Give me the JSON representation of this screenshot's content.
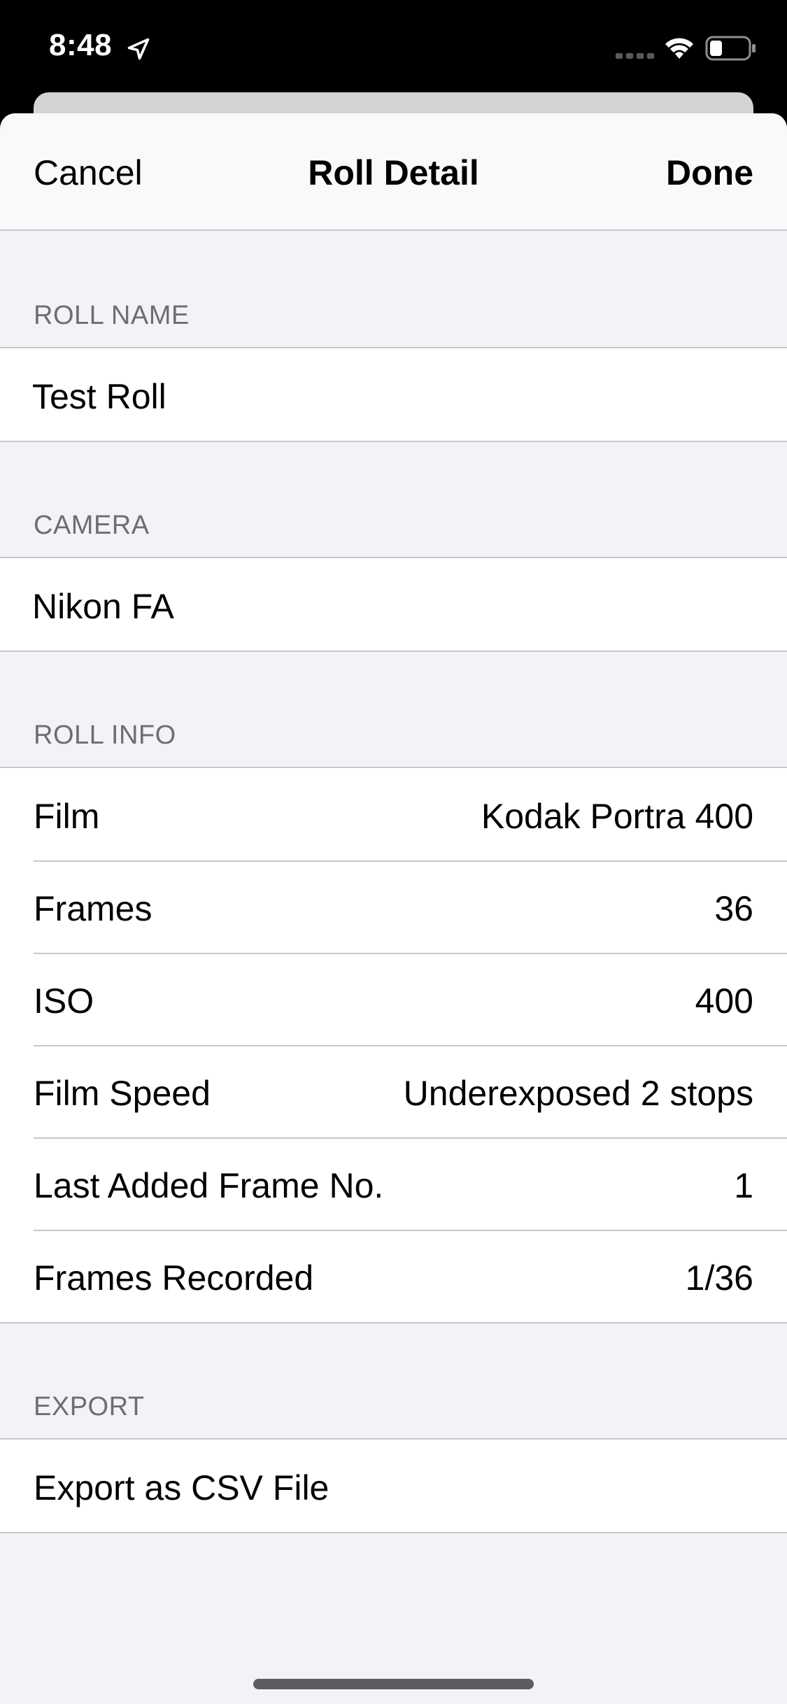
{
  "status_bar": {
    "time": "8:48",
    "location_icon": "location-arrow-icon",
    "signal_icon": "cellular-signal-icon",
    "wifi_icon": "wifi-icon",
    "battery_icon": "battery-icon",
    "battery_level": 0.3
  },
  "nav": {
    "cancel_label": "Cancel",
    "title": "Roll Detail",
    "done_label": "Done"
  },
  "sections": {
    "roll_name": {
      "header": "ROLL NAME",
      "value": "Test Roll"
    },
    "camera": {
      "header": "CAMERA",
      "value": "Nikon FA"
    },
    "roll_info": {
      "header": "ROLL INFO",
      "rows": [
        {
          "label": "Film",
          "value": "Kodak Portra 400"
        },
        {
          "label": "Frames",
          "value": "36"
        },
        {
          "label": "ISO",
          "value": "400"
        },
        {
          "label": "Film Speed",
          "value": "Underexposed 2 stops"
        },
        {
          "label": "Last Added Frame No.",
          "value": "1"
        },
        {
          "label": "Frames Recorded",
          "value": "1/36"
        }
      ]
    },
    "export": {
      "header": "EXPORT",
      "action_label": "Export as CSV File"
    }
  },
  "colors": {
    "background": "#f2f2f7",
    "nav_background": "#f9f9fb",
    "section_header": "#6d6d72",
    "separator": "#c8c8cc",
    "text": "#000000"
  }
}
